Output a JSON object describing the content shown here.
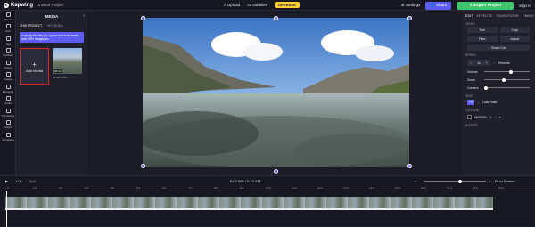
{
  "topbar": {
    "brand": "Kapwing",
    "project_title": "Untitled Project",
    "upload": "Upload",
    "subtitles": "Subtitles",
    "upgrade": "UPGRADE",
    "settings": "Settings",
    "share": "Share",
    "export": "Export Project",
    "signin": "Sign In"
  },
  "iconbar": [
    "Media",
    "Edit",
    "Text",
    "Subtitles",
    "Videos",
    "Images",
    "Elements",
    "Audio",
    "Transitions",
    "Plugins",
    "Templates"
  ],
  "media_panel": {
    "title": "MEDIA",
    "tabs": [
      "THIS PROJECT",
      "MY MEDIA"
    ],
    "banner": "Kapwing Pro lets you upload and store assets over 250+ megabytes",
    "add_media": "Add Media",
    "thumb_duration": "00:13",
    "thumb_name": "pexels-video..."
  },
  "right_panel": {
    "tabs": [
      "EDIT",
      "EFFECTS",
      "TRANSITIONS",
      "TIMING"
    ],
    "video_label": "VIDEO",
    "buttons": [
      "Trim",
      "Crop",
      "Filter",
      "Adjust"
    ],
    "smart_cut": "Smart Cut",
    "speed_label": "SPEED",
    "speed_value": "1x",
    "reverse": "Reverse",
    "volume": "Volume",
    "zoom": "Zoom",
    "corners": "Corners",
    "size_label": "SIZE",
    "fit": "Fit",
    "lock_ratio": "Lock Ratio",
    "outline_label": "OUTLINE",
    "color": "#000000",
    "rotate_label": "ROTATE"
  },
  "timeline": {
    "speed": "1.0x",
    "split": "Split",
    "time": "0:00.000 / 0:13.413",
    "fit_screen": "Fit to Screen",
    "ticks": [
      "0",
      "1.0",
      "2.0",
      "3.0",
      "4.0",
      "5.0",
      "6.0",
      "7.0",
      "8.0",
      "9.0",
      "10.0",
      "11.0",
      "12.0",
      "13.0",
      "14.0",
      "15.0",
      "16.0",
      "17.0",
      "18.0",
      "19.0"
    ]
  }
}
